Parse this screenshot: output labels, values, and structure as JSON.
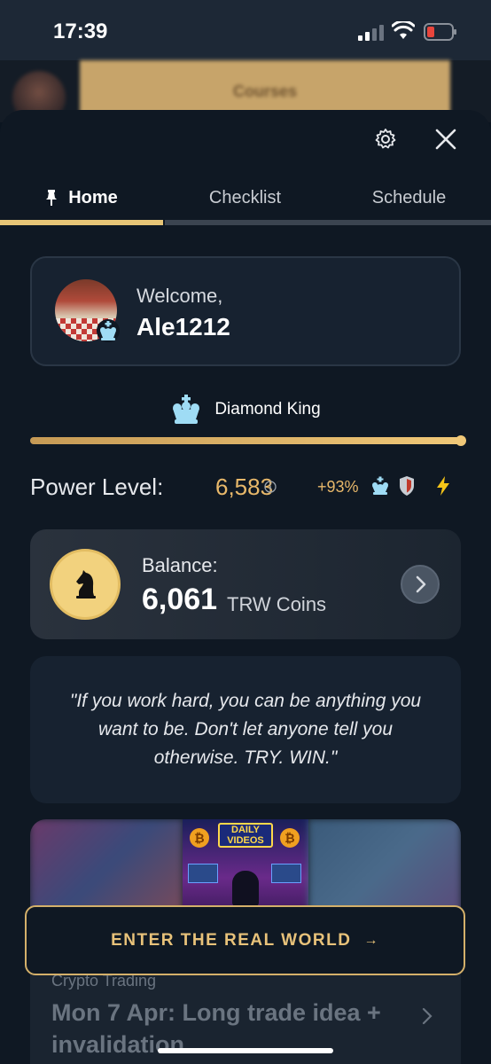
{
  "status_bar": {
    "time": "17:39"
  },
  "background": {
    "course_button": "Courses"
  },
  "tabs": [
    {
      "label": "Home"
    },
    {
      "label": "Checklist"
    },
    {
      "label": "Schedule"
    }
  ],
  "welcome": {
    "label": "Welcome,",
    "username": "Ale1212"
  },
  "rank": {
    "title": "Diamond King",
    "progress_fraction": 1.0
  },
  "power": {
    "label": "Power Level:",
    "value": "6,583",
    "percent": "+93%"
  },
  "balance": {
    "label": "Balance:",
    "value": "6,061",
    "unit": "TRW Coins"
  },
  "quote": {
    "text": "\"If you work hard, you can be anything you want to be. Don't let anyone tell you otherwise. TRY. WIN.\""
  },
  "video": {
    "thumbnail_title": "DAILY VIDEOS",
    "category": "Crypto Trading",
    "title": "Mon 7 Apr: Long trade idea + invalidation"
  },
  "cta": {
    "label": "ENTER THE REAL WORLD",
    "arrow": "→"
  },
  "colors": {
    "accent_gold": "#e8b86a",
    "rank_blue": "#9fdcf5",
    "background": "#0f1823"
  }
}
